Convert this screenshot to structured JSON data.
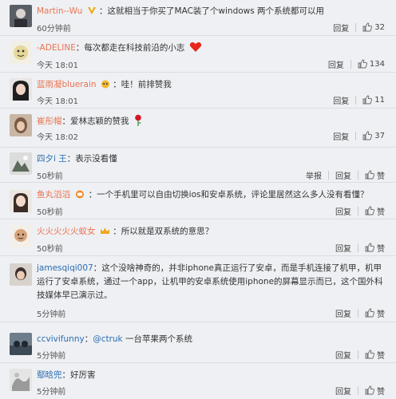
{
  "comments": [
    {
      "name": "Martin--Wu",
      "text": "这就相当于你买了MAC装了个windows   两个系统都可以用",
      "time": "60分钟前",
      "reply": "回复",
      "likes": "32"
    },
    {
      "name": "-ADELINE",
      "text": "每次都走在科技前沿的小志",
      "time": "今天 18:01",
      "reply": "回复",
      "likes": "134"
    },
    {
      "name": "蓝雨凝bluerain",
      "text": "哇！前排赞我",
      "time": "今天 18:01",
      "reply": "回复",
      "likes": "11"
    },
    {
      "name": "崔彤帽",
      "text": "爱林志颖的赞我",
      "time": "今天 18:02",
      "reply": "回复",
      "likes": "37"
    },
    {
      "name": "四夕i  王",
      "text": "表示没看懂",
      "time": "50秒前",
      "report": "举报",
      "reply": "回复",
      "likes": "赞"
    },
    {
      "name": "鱼丸滔滔",
      "text": "一个手机里可以自由切换ios和安卓系统，评论里居然这么多人没有看懂？",
      "time": "50秒前",
      "reply": "回复",
      "likes": "赞"
    },
    {
      "name": "火火火火火蚁女",
      "text": "所以就是双系统的意思？",
      "time": "50秒前",
      "reply": "回复",
      "likes": "赞"
    },
    {
      "name": "jamesqiqi007",
      "text": "这个没啥神奇的，并非iphone真正运行了安卓，而是手机连接了机甲，机甲运行了安卓系统，通过一个app，让机甲的安卓系统使用iphone的屏幕显示而已，这个国外科技媒体早已演示过。",
      "time": "5分钟前",
      "reply": "回复",
      "likes": "赞"
    },
    {
      "name": "ccvivifunny",
      "at": "@ctruk",
      "text": "一台苹果两个系统",
      "time": "5分钟前",
      "reply": "回复",
      "likes": "赞"
    },
    {
      "name": "鄢晗兜",
      "text": "好厉害",
      "time": "5分钟前",
      "reply": "回复",
      "likes": "赞"
    }
  ],
  "colors": {
    "name": "#eb7350",
    "link": "#2b6cb0",
    "text": "#333333",
    "muted": "#555555",
    "divider": "#dadde2",
    "background": "#eef0f3"
  }
}
